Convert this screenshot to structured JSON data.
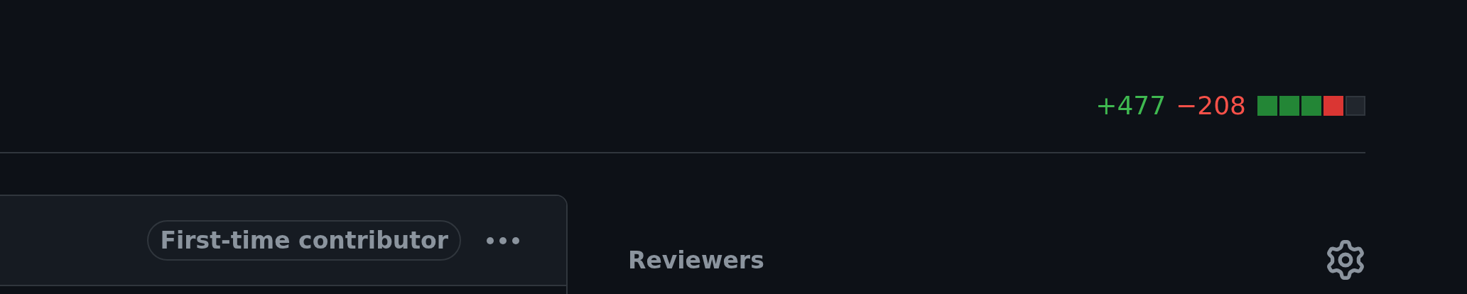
{
  "diffstat": {
    "additions": "+477",
    "deletions": "−208",
    "blocks": [
      {
        "kind": "added"
      },
      {
        "kind": "added"
      },
      {
        "kind": "added"
      },
      {
        "kind": "deleted"
      },
      {
        "kind": "neutral"
      }
    ]
  },
  "comment_header": {
    "badge": "First-time contributor"
  },
  "sidebar": {
    "section_title": "Reviewers"
  }
}
